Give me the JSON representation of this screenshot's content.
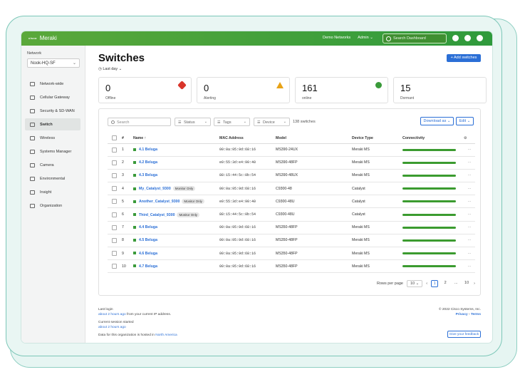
{
  "app": {
    "brand_small": "cisco",
    "brand": "Meraki"
  },
  "topbar": {
    "org_link": "Demo Networks",
    "admin_link": "Admin",
    "search_placeholder": "Search Dashboard"
  },
  "sidebar": {
    "network_label": "Network",
    "network_value": "Nook-HQ-SF",
    "items": [
      {
        "label": "Network-wide",
        "icon": "network-wide-icon"
      },
      {
        "label": "Cellular Gateway",
        "icon": "cellular-gateway-icon"
      },
      {
        "label": "Security & SD-WAN",
        "icon": "security-icon"
      },
      {
        "label": "Switch",
        "icon": "switch-icon",
        "active": true
      },
      {
        "label": "Wireless",
        "icon": "wireless-icon"
      },
      {
        "label": "Systems Manager",
        "icon": "systems-manager-icon"
      },
      {
        "label": "Camera",
        "icon": "camera-icon"
      },
      {
        "label": "Environmental",
        "icon": "environmental-icon"
      },
      {
        "label": "Insight",
        "icon": "insight-icon"
      },
      {
        "label": "Organization",
        "icon": "organization-icon"
      }
    ]
  },
  "page": {
    "title": "Switches",
    "timeframe": "Last day",
    "add_button": "+ Add switches"
  },
  "stats": [
    {
      "value": "0",
      "label": "Offline",
      "color": "#d9352b"
    },
    {
      "value": "0",
      "label": "Alerting",
      "color": "#e8a317"
    },
    {
      "value": "161",
      "label": "online",
      "color": "#3a9a3a"
    },
    {
      "value": "15",
      "label": "Dormant",
      "color": ""
    }
  ],
  "filters": {
    "search_placeholder": "Search",
    "status": "Status",
    "tags": "Tags",
    "device": "Device",
    "count": "138 switches",
    "download": "Download as",
    "edit": "Edit"
  },
  "table": {
    "headers": {
      "num": "#",
      "name": "Name",
      "mac": "MAC Address",
      "model": "Model",
      "type": "Device Type",
      "conn": "Connectivity"
    },
    "rows": [
      {
        "n": "1",
        "name": "4.1 Beluga",
        "badge": "",
        "mac": "00:0a:95:9d:68:16",
        "model": "MS390-24UX",
        "type": "Meraki MS"
      },
      {
        "n": "2",
        "name": "4.2 Beluga",
        "badge": "",
        "mac": "e0:55:3d:e4:90:40",
        "model": "MS390-48FP",
        "type": "Meraki MS"
      },
      {
        "n": "3",
        "name": "4.3 Beluga",
        "badge": "",
        "mac": "88:15:44:5c:0b:54",
        "model": "MS390-48UX",
        "type": "Meraki MS"
      },
      {
        "n": "4",
        "name": "My_Catalyst_9300",
        "badge": "Monitor Only",
        "mac": "00:0a:95:9d:68:16",
        "model": "C9300-48",
        "type": "Catalyst"
      },
      {
        "n": "5",
        "name": "Another_Catalyst_9300",
        "badge": "Monitor Only",
        "mac": "e0:55:3d:e4:90:40",
        "model": "C9300-48U",
        "type": "Catalyst"
      },
      {
        "n": "6",
        "name": "Third_Catalyst_9300",
        "badge": "Monitor Only",
        "mac": "88:15:44:5c:0b:54",
        "model": "C9300-48U",
        "type": "Catalyst"
      },
      {
        "n": "7",
        "name": "4.4 Beluga",
        "badge": "",
        "mac": "00:0a:95:9d:68:16",
        "model": "MS350-48FP",
        "type": "Meraki MS"
      },
      {
        "n": "8",
        "name": "4.5 Beluga",
        "badge": "",
        "mac": "00:0a:95:9d:68:16",
        "model": "MS350-48FP",
        "type": "Meraki MS"
      },
      {
        "n": "9",
        "name": "4.6 Beluga",
        "badge": "",
        "mac": "00:0a:95:9d:68:16",
        "model": "MS350-48FP",
        "type": "Meraki MS"
      },
      {
        "n": "10",
        "name": "4.7 Beluga",
        "badge": "",
        "mac": "00:0a:95:9d:68:16",
        "model": "MS350-48FP",
        "type": "Meraki MS"
      }
    ]
  },
  "pager": {
    "label": "Rows per page",
    "rows": "10",
    "pages": [
      "1",
      "2",
      "...",
      "10"
    ]
  },
  "footer": {
    "last_login_label": "Last login",
    "last_login_value": "about 2 hours ago",
    "last_login_suffix": "from your current IP address.",
    "session_label": "Current session started",
    "session_value": "about 2 hours ago",
    "data_note": "Data for this organization is hosted in",
    "data_region": "North America",
    "copyright": "© 2022 Cisco Systems, Inc.",
    "privacy": "Privacy",
    "terms": "Terms",
    "feedback": "Give your feedback"
  }
}
